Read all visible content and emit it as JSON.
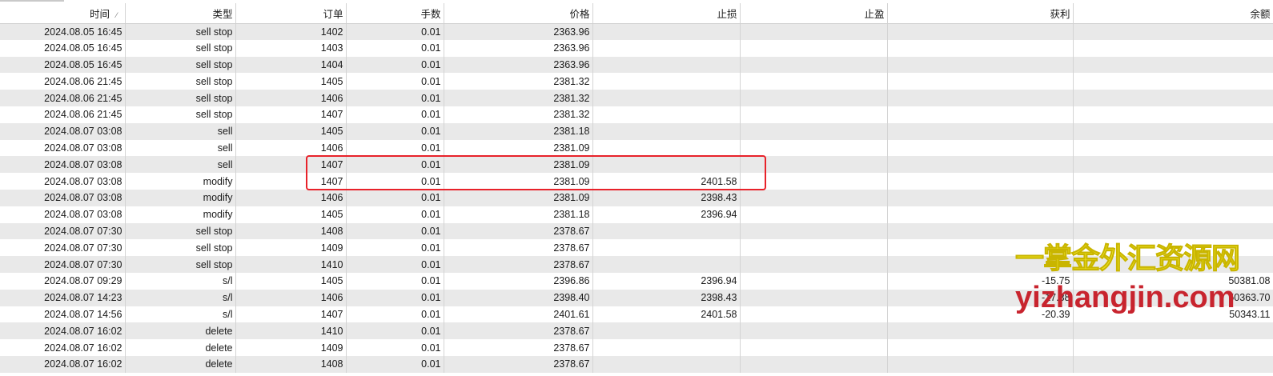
{
  "headers": [
    "时间",
    "类型",
    "订单",
    "手数",
    "价格",
    "止损",
    "止盈",
    "获利",
    "余额"
  ],
  "sort_indicator": "⁄",
  "rows": [
    [
      "2024.08.05 16:45",
      "sell stop",
      "1402",
      "0.01",
      "2363.96",
      "",
      "",
      "",
      ""
    ],
    [
      "2024.08.05 16:45",
      "sell stop",
      "1403",
      "0.01",
      "2363.96",
      "",
      "",
      "",
      ""
    ],
    [
      "2024.08.05 16:45",
      "sell stop",
      "1404",
      "0.01",
      "2363.96",
      "",
      "",
      "",
      ""
    ],
    [
      "2024.08.06 21:45",
      "sell stop",
      "1405",
      "0.01",
      "2381.32",
      "",
      "",
      "",
      ""
    ],
    [
      "2024.08.06 21:45",
      "sell stop",
      "1406",
      "0.01",
      "2381.32",
      "",
      "",
      "",
      ""
    ],
    [
      "2024.08.06 21:45",
      "sell stop",
      "1407",
      "0.01",
      "2381.32",
      "",
      "",
      "",
      ""
    ],
    [
      "2024.08.07 03:08",
      "sell",
      "1405",
      "0.01",
      "2381.18",
      "",
      "",
      "",
      ""
    ],
    [
      "2024.08.07 03:08",
      "sell",
      "1406",
      "0.01",
      "2381.09",
      "",
      "",
      "",
      ""
    ],
    [
      "2024.08.07 03:08",
      "sell",
      "1407",
      "0.01",
      "2381.09",
      "",
      "",
      "",
      ""
    ],
    [
      "2024.08.07 03:08",
      "modify",
      "1407",
      "0.01",
      "2381.09",
      "2401.58",
      "",
      "",
      ""
    ],
    [
      "2024.08.07 03:08",
      "modify",
      "1406",
      "0.01",
      "2381.09",
      "2398.43",
      "",
      "",
      ""
    ],
    [
      "2024.08.07 03:08",
      "modify",
      "1405",
      "0.01",
      "2381.18",
      "2396.94",
      "",
      "",
      ""
    ],
    [
      "2024.08.07 07:30",
      "sell stop",
      "1408",
      "0.01",
      "2378.67",
      "",
      "",
      "",
      ""
    ],
    [
      "2024.08.07 07:30",
      "sell stop",
      "1409",
      "0.01",
      "2378.67",
      "",
      "",
      "",
      ""
    ],
    [
      "2024.08.07 07:30",
      "sell stop",
      "1410",
      "0.01",
      "2378.67",
      "",
      "",
      "",
      ""
    ],
    [
      "2024.08.07 09:29",
      "s/l",
      "1405",
      "0.01",
      "2396.86",
      "2396.94",
      "",
      "-15.75",
      "50381.08"
    ],
    [
      "2024.08.07 14:23",
      "s/l",
      "1406",
      "0.01",
      "2398.40",
      "2398.43",
      "",
      "-17.38",
      "50363.70"
    ],
    [
      "2024.08.07 14:56",
      "s/l",
      "1407",
      "0.01",
      "2401.61",
      "2401.58",
      "",
      "-20.39",
      "50343.11"
    ],
    [
      "2024.08.07 16:02",
      "delete",
      "1410",
      "0.01",
      "2378.67",
      "",
      "",
      "",
      ""
    ],
    [
      "2024.08.07 16:02",
      "delete",
      "1409",
      "0.01",
      "2378.67",
      "",
      "",
      "",
      ""
    ],
    [
      "2024.08.07 16:02",
      "delete",
      "1408",
      "0.01",
      "2378.67",
      "",
      "",
      "",
      ""
    ]
  ],
  "watermark": {
    "cn": "一掌金外汇资源网",
    "url": "yizhangjin.com"
  },
  "colors": {
    "highlight": "#e8222a",
    "row_alt": "#e9e9e9",
    "watermark_cn": "#f5ed2a",
    "watermark_url": "#c8242e"
  }
}
